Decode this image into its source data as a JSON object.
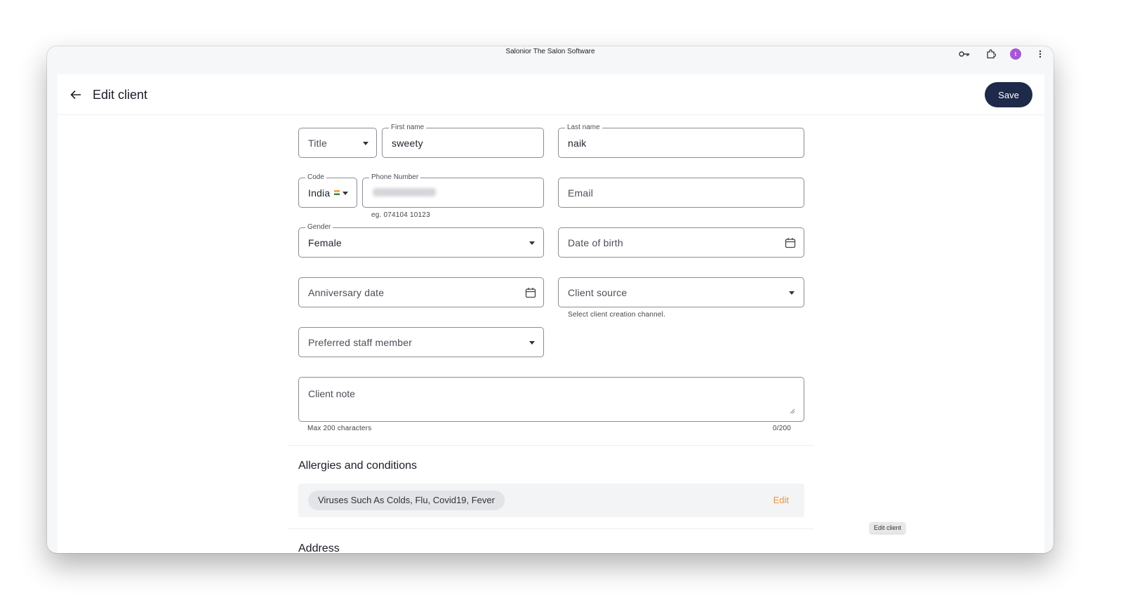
{
  "window": {
    "title": "Salonior The Salon Software",
    "avatar_letter": "t"
  },
  "header": {
    "title": "Edit client",
    "save_label": "Save"
  },
  "form": {
    "title_placeholder": "Title",
    "first_name_label": "First name",
    "first_name_value": "sweety",
    "last_name_label": "Last name",
    "last_name_value": "naik",
    "code_label": "Code",
    "code_value": "India",
    "phone_label": "Phone Number",
    "phone_helper": "eg. 074104 10123",
    "email_placeholder": "Email",
    "gender_label": "Gender",
    "gender_value": "Female",
    "dob_placeholder": "Date of birth",
    "anniversary_placeholder": "Anniversary date",
    "client_source_placeholder": "Client source",
    "client_source_helper": "Select client creation channel.",
    "staff_placeholder": "Preferred staff member",
    "note_placeholder": "Client note",
    "note_helper": "Max 200 characters",
    "note_counter": "0/200"
  },
  "allergies": {
    "title": "Allergies and conditions",
    "chip": "Viruses Such As Colds, Flu, Covid19, Fever",
    "edit_label": "Edit"
  },
  "address": {
    "title": "Address"
  },
  "tooltip": "Edit client",
  "colors": {
    "save_button": "#1e2a4a",
    "edit_link": "#e8953a",
    "avatar": "#a855d6"
  }
}
